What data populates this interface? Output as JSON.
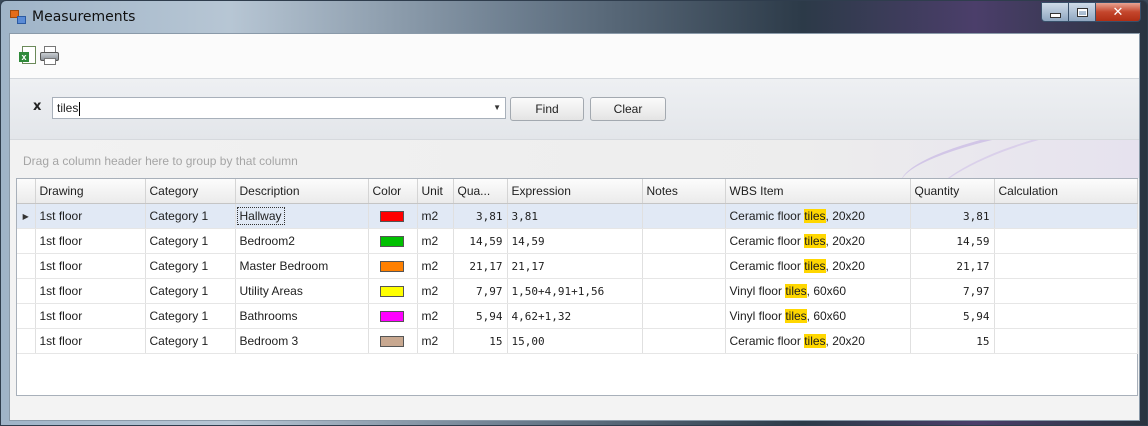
{
  "window": {
    "title": "Measurements"
  },
  "toolbar": {
    "export_icon": "excel-export-icon",
    "print_icon": "printer-icon"
  },
  "find": {
    "close_glyph": "x",
    "search_value": "tiles",
    "find_label": "Find",
    "clear_label": "Clear"
  },
  "group_panel": {
    "hint": "Drag a column header here to group by that column"
  },
  "colors": {
    "highlight": "#ffd700",
    "selected_row": "#e1e9f5"
  },
  "grid": {
    "columns": [
      "Drawing",
      "Category",
      "Description",
      "Color",
      "Unit",
      "Qua...",
      "Expression",
      "Notes",
      "WBS Item",
      "Quantity",
      "Calculation"
    ],
    "highlight_term": "tiles",
    "rows": [
      {
        "drawing": "1st floor",
        "category": "Category 1",
        "description": "Hallway",
        "color": "#ff0000",
        "unit": "m2",
        "qua": "3,81",
        "expression": "3,81",
        "notes": "",
        "wbs_pre": "Ceramic floor ",
        "wbs_hl": "tiles",
        "wbs_post": ", 20x20",
        "quantity": "3,81",
        "calculation": ""
      },
      {
        "drawing": "1st floor",
        "category": "Category 1",
        "description": "Bedroom2",
        "color": "#00c000",
        "unit": "m2",
        "qua": "14,59",
        "expression": "14,59",
        "notes": "",
        "wbs_pre": "Ceramic floor ",
        "wbs_hl": "tiles",
        "wbs_post": ", 20x20",
        "quantity": "14,59",
        "calculation": ""
      },
      {
        "drawing": "1st floor",
        "category": "Category 1",
        "description": "Master Bedroom",
        "color": "#ff8000",
        "unit": "m2",
        "qua": "21,17",
        "expression": "21,17",
        "notes": "",
        "wbs_pre": "Ceramic floor ",
        "wbs_hl": "tiles",
        "wbs_post": ", 20x20",
        "quantity": "21,17",
        "calculation": ""
      },
      {
        "drawing": "1st floor",
        "category": "Category 1",
        "description": "Utility Areas",
        "color": "#ffff00",
        "unit": "m2",
        "qua": "7,97",
        "expression": "1,50+4,91+1,56",
        "notes": "",
        "wbs_pre": "Vinyl floor ",
        "wbs_hl": "tiles",
        "wbs_post": ", 60x60",
        "quantity": "7,97",
        "calculation": ""
      },
      {
        "drawing": "1st floor",
        "category": "Category 1",
        "description": "Bathrooms",
        "color": "#ff00ff",
        "unit": "m2",
        "qua": "5,94",
        "expression": "4,62+1,32",
        "notes": "",
        "wbs_pre": "Vinyl floor ",
        "wbs_hl": "tiles",
        "wbs_post": ", 60x60",
        "quantity": "5,94",
        "calculation": ""
      },
      {
        "drawing": "1st floor",
        "category": "Category 1",
        "description": "Bedroom 3",
        "color": "#c8a890",
        "unit": "m2",
        "qua": "15",
        "expression": "15,00",
        "notes": "",
        "wbs_pre": "Ceramic floor ",
        "wbs_hl": "tiles",
        "wbs_post": ", 20x20",
        "quantity": "15",
        "calculation": ""
      }
    ],
    "selected_row": 0
  }
}
